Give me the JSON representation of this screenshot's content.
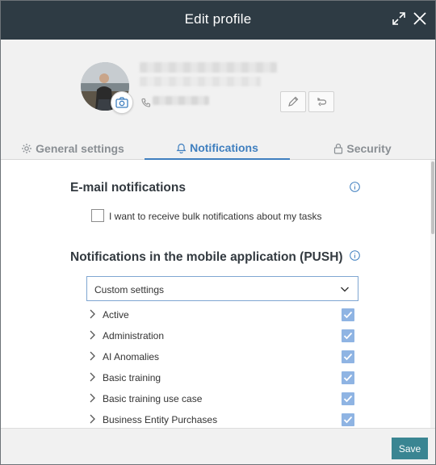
{
  "window": {
    "title": "Edit profile"
  },
  "tabs": [
    {
      "label": "General settings",
      "icon": "gear-icon",
      "active": false
    },
    {
      "label": "Notifications",
      "icon": "bell-icon",
      "active": true
    },
    {
      "label": "Security",
      "icon": "lock-icon",
      "active": false
    }
  ],
  "email_section": {
    "title": "E-mail notifications",
    "checkbox_label": "I want to receive bulk notifications about my tasks",
    "checked": false
  },
  "push_section": {
    "title": "Notifications in the mobile application (PUSH)",
    "select_value": "Custom settings",
    "items": [
      {
        "label": "Active",
        "checked": true
      },
      {
        "label": "Administration",
        "checked": true
      },
      {
        "label": "AI Anomalies",
        "checked": true
      },
      {
        "label": "Basic training",
        "checked": true
      },
      {
        "label": "Basic training use case",
        "checked": true
      },
      {
        "label": "Business Entity Purchases",
        "checked": true
      }
    ]
  },
  "footer": {
    "save_label": "Save"
  },
  "colors": {
    "titlebar": "#2e3b44",
    "accent": "#3f7fbf",
    "save": "#3a8592",
    "checked": "#8fb4e3"
  }
}
